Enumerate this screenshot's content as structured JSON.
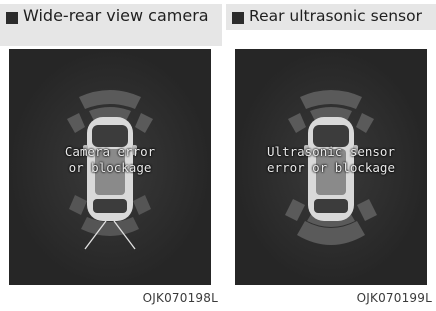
{
  "panels": [
    {
      "title": "Wide-rear view camera",
      "message": "Camera error\nor blockage",
      "code": "OJK070198L"
    },
    {
      "title": "Rear ultrasonic sensor",
      "message": "Ultrasonic sensor\nerror or blockage",
      "code": "OJK070199L"
    }
  ],
  "icons": {
    "bullet": "square-bullet-icon",
    "car": "car-top-view-icon"
  },
  "colors": {
    "screen": "#262626",
    "sensor_zone": "#5a5a5a",
    "header": "#e6e6e6"
  }
}
